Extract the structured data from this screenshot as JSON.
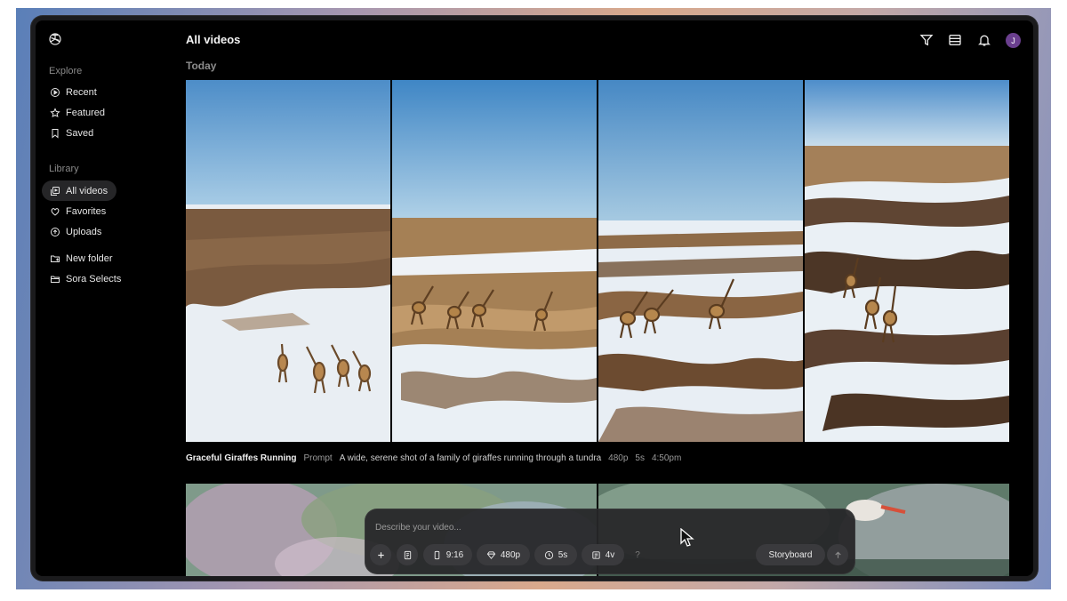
{
  "sidebar": {
    "explore_label": "Explore",
    "explore_items": [
      {
        "label": "Recent",
        "icon": "play-circle-icon"
      },
      {
        "label": "Featured",
        "icon": "star-icon"
      },
      {
        "label": "Saved",
        "icon": "bookmark-icon"
      }
    ],
    "library_label": "Library",
    "library_items": [
      {
        "label": "All videos",
        "icon": "videos-icon",
        "active": true
      },
      {
        "label": "Favorites",
        "icon": "heart-icon"
      },
      {
        "label": "Uploads",
        "icon": "upload-icon"
      }
    ],
    "folder_items": [
      {
        "label": "New folder",
        "icon": "new-folder-icon"
      },
      {
        "label": "Sora Selects",
        "icon": "folder-icon"
      }
    ]
  },
  "header": {
    "title": "All videos",
    "avatar_initial": "J"
  },
  "feed": {
    "group_label": "Today",
    "video": {
      "title": "Graceful Giraffes Running",
      "prompt_label": "Prompt",
      "prompt": "A wide, serene shot of a family of giraffes running through a tundra",
      "resolution": "480p",
      "duration": "5s",
      "time": "4:50pm"
    }
  },
  "composer": {
    "placeholder": "Describe your video...",
    "aspect": "9:16",
    "resolution": "480p",
    "duration": "5s",
    "variations": "4v",
    "help": "?",
    "storyboard": "Storyboard"
  },
  "colors": {
    "background": "#000000",
    "active_nav": "#262628",
    "composer": "#262628",
    "pill": "#3a3a3d",
    "avatar": "#6a3f8e"
  }
}
